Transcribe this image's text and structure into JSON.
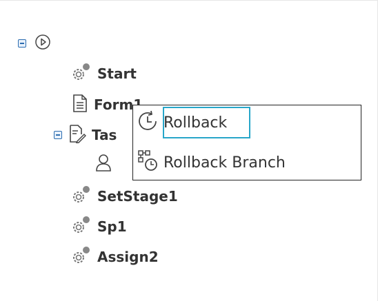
{
  "tree": {
    "nodes": [
      {
        "id": "root",
        "label": "",
        "icon": "play-circle-icon"
      },
      {
        "id": "start",
        "label": "Start",
        "icon": "gear-icon"
      },
      {
        "id": "form1",
        "label": "Form1",
        "icon": "document-icon"
      },
      {
        "id": "task",
        "label": "Tas",
        "icon": "task-edit-icon"
      },
      {
        "id": "user",
        "label": "",
        "icon": "user-icon"
      },
      {
        "id": "setstage1",
        "label": "SetStage1",
        "icon": "gear-icon"
      },
      {
        "id": "sp1",
        "label": "Sp1",
        "icon": "gear-icon"
      },
      {
        "id": "assign2",
        "label": "Assign2",
        "icon": "gear-icon"
      }
    ]
  },
  "context_menu": {
    "items": [
      {
        "label": "Rollback",
        "icon": "clock-rollback-icon",
        "focused": true
      },
      {
        "label": "Rollback Branch",
        "icon": "branch-rollback-icon",
        "focused": false
      }
    ]
  },
  "colors": {
    "toggle": "#2b6cb0",
    "focus_outline": "#27a6c9"
  }
}
